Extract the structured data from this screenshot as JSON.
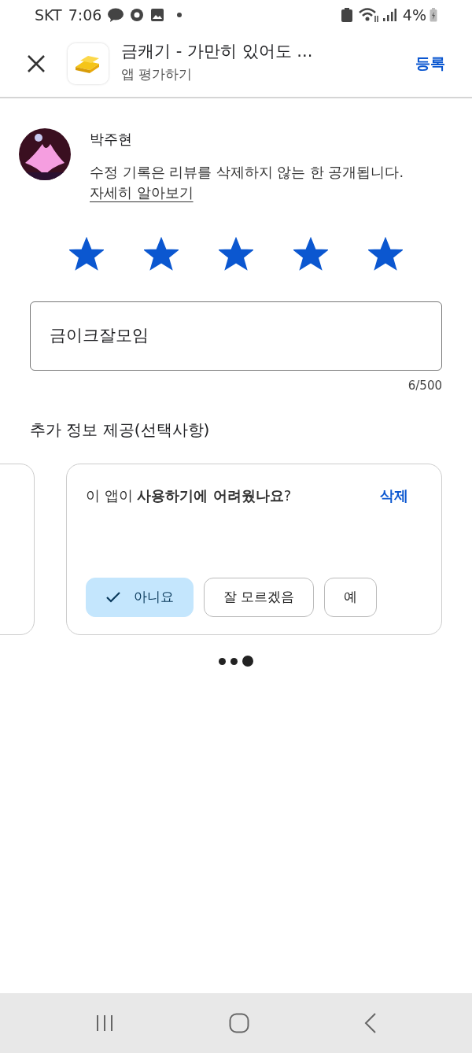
{
  "status_bar": {
    "carrier": "SKT",
    "time": "7:06",
    "battery": "4%"
  },
  "header": {
    "title": "금캐기 - 가만히 있어도 ...",
    "subtitle": "앱 평가하기",
    "action": "등록"
  },
  "user": {
    "name": "박주현",
    "notice": "수정 기록은 리뷰를 삭제하지 않는 한 공개됩니다.",
    "link": "자세히 알아보기"
  },
  "rating": {
    "stars": 5
  },
  "review": {
    "value": "금이크잘모임",
    "counter": "6/500"
  },
  "extra": {
    "heading": "추가 정보 제공(선택사항)",
    "question": {
      "text": "이 앱이 **사용하기에 어려웠나요**?",
      "action": "삭제",
      "options": [
        {
          "label": "아니요",
          "selected": true
        },
        {
          "label": "잘 모르겠음",
          "selected": false
        },
        {
          "label": "예",
          "selected": false
        }
      ]
    },
    "pages": [
      {
        "selected": false
      },
      {
        "selected": false
      },
      {
        "selected": true
      }
    ]
  }
}
